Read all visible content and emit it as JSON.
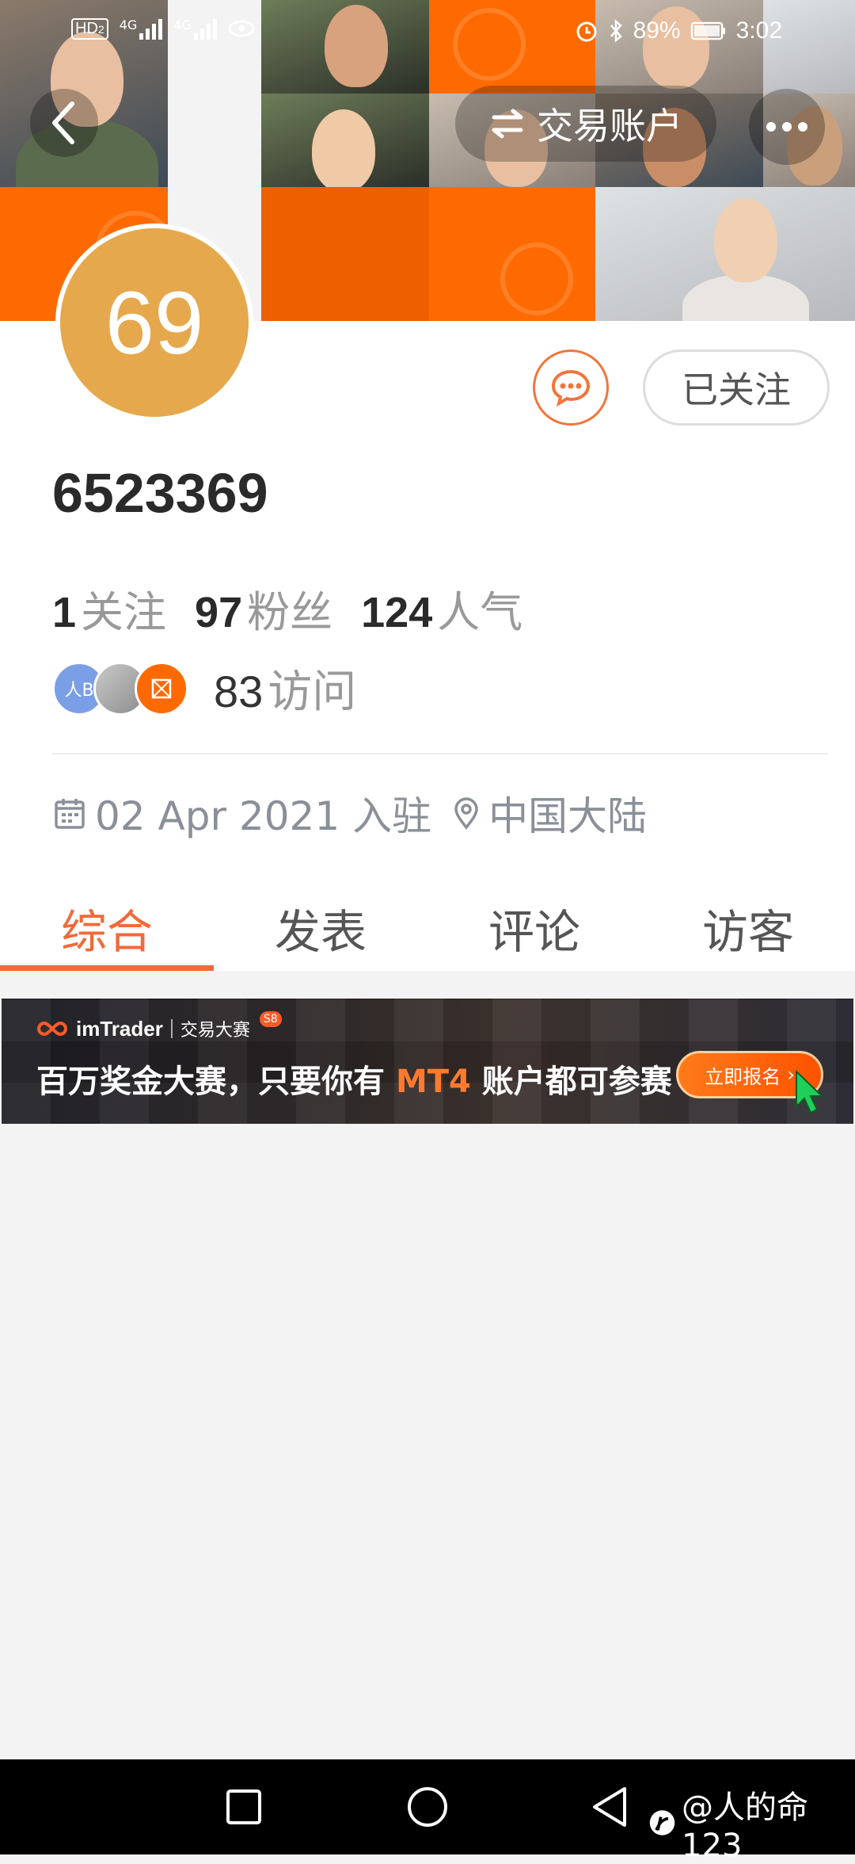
{
  "status_bar": {
    "network_badge": "HD",
    "network_sub": "2",
    "signal_1": "4G",
    "signal_2": "4G",
    "battery": "89%",
    "time": "3:02"
  },
  "header": {
    "switch_label": "交易账户"
  },
  "profile": {
    "avatar_text": "69",
    "avatar_color": "#e5a84c",
    "follow_button": "已关注",
    "username": "6523369",
    "following_count": "1",
    "following_label": "关注",
    "fans_count": "97",
    "fans_label": "粉丝",
    "popularity_count": "124",
    "popularity_label": "人气",
    "visitor_avatar_1": "人B",
    "visits_count": "83",
    "visits_label": "访问",
    "join_date": "02 Apr 2021 入驻",
    "location": "中国大陆"
  },
  "tabs": [
    {
      "label": "综合",
      "active": true
    },
    {
      "label": "发表",
      "active": false
    },
    {
      "label": "评论",
      "active": false
    },
    {
      "label": "访客",
      "active": false
    }
  ],
  "banner": {
    "brand": "imTrader",
    "subtitle": "交易大赛",
    "season_badge": "S8",
    "headline_a": "百万奖金大赛，只要你有 ",
    "headline_hl": "MT4",
    "headline_b": " 账户都可参赛",
    "cta": "立即报名"
  },
  "watermark": "@人的命123",
  "colors": {
    "accent": "#f06a3a",
    "header_orange": "#ff6a00"
  }
}
